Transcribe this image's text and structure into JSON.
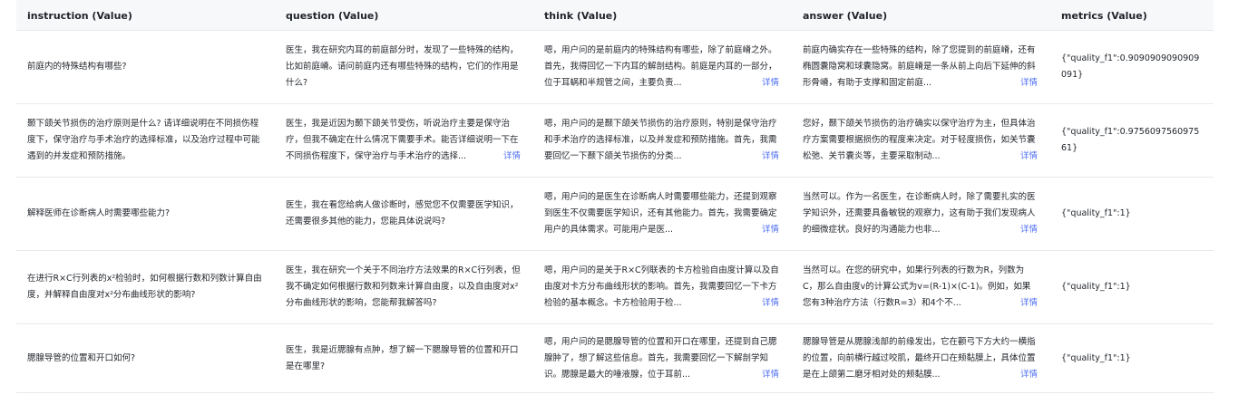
{
  "headers": [
    "instruction (Value)",
    "question (Value)",
    "think (Value)",
    "answer (Value)",
    "metrics (Value)"
  ],
  "more_label": "详情",
  "rows": [
    {
      "instruction": "前庭内的特殊结构有哪些?",
      "question": "医生，我在研究内耳的前庭部分时，发现了一些特殊的结构，比如前庭嵴。请问前庭内还有哪些特殊的结构，它们的作用是什么?",
      "think": "嗯，用户问的是前庭内的特殊结构有哪些，除了前庭嵴之外。首先，我得回忆一下内耳的解剖结构。前庭是内耳的一部分，位于耳蜗和半规管之间，主要负责...",
      "answer": "前庭内确实存在一些特殊的结构，除了您提到的前庭嵴，还有椭圆囊隐窝和球囊隐窝。前庭嵴是一条从前上向后下延伸的斜形骨嵴，有助于支撑和固定前庭...",
      "metrics": "{\"quality_f1\":0.9090909090909091}"
    },
    {
      "instruction": "颞下颌关节损伤的治疗原则是什么? 请详细说明在不同损伤程度下，保守治疗与手术治疗的选择标准，以及治疗过程中可能遇到的并发症和预防措施。",
      "question": "医生，我是近因为颞下颌关节受伤，听说治疗主要是保守治疗，但我不确定在什么情况下需要手术。能否详细说明一下在不同损伤程度下，保守治疗与手术治疗的选择...",
      "think": "嗯，用户问的是颞下颌关节损伤的治疗原则，特别是保守治疗和手术治疗的选择标准，以及并发症和预防措施。首先，我需要回忆一下颞下颌关节损伤的分类...",
      "answer": "您好，颞下颌关节损伤的治疗确实以保守治疗为主，但具体治疗方案需要根据损伤的程度来决定。对于轻度损伤，如关节囊松弛、关节囊炎等，主要采取制动...",
      "metrics": "{\"quality_f1\":0.975609756097561}"
    },
    {
      "instruction": "解释医师在诊断病人时需要哪些能力?",
      "question": "医生，我在看您给病人做诊断时，感觉您不仅需要医学知识，还需要很多其他的能力，您能具体说说吗?",
      "think": "嗯，用户问的是医生在诊断病人时需要哪些能力，还提到观察到医生不仅需要医学知识，还有其他能力。首先，我需要确定用户的具体需求。可能用户是医...",
      "answer": "当然可以。作为一名医生，在诊断病人时，除了需要扎实的医学知识外，还需要具备敏锐的观察力，这有助于我们发现病人的细微症状。良好的沟通能力也非...",
      "metrics": "{\"quality_f1\":1}"
    },
    {
      "instruction": "在进行R×C行列表的x²检验时，如何根据行数和列数计算自由度，并解释自由度对x²分布曲线形状的影响?",
      "question": "医生，我在研究一个关于不同治疗方法效果的R×C行列表，但我不确定如何根据行数和列数来计算自由度，以及自由度对x²分布曲线形状的影响，您能帮我解答吗?",
      "think": "嗯，用户问的是关于R×C列联表的卡方检验自由度计算以及自由度对卡方分布曲线形状的影响。首先，我需要回忆一下卡方检验的基本概念。卡方检验用于检...",
      "answer": "当然可以。在您的研究中，如果行列表的行数为R，列数为C，那么自由度v的计算公式为v=(R-1)×(C-1)。例如，如果您有3种治疗方法（行数R=3）和4个不...",
      "metrics": "{\"quality_f1\":1}"
    },
    {
      "instruction": "腮腺导管的位置和开口如何?",
      "question": "医生，我是近腮腺有点肿，想了解一下腮腺导管的位置和开口是在哪里?",
      "think": "嗯，用户问的是腮腺导管的位置和开口在哪里，还提到自己腮腺肿了，想了解这些信息。首先，我需要回忆一下解剖学知识。腮腺是最大的唾液腺，位于耳前...",
      "answer": "腮腺导管是从腮腺浅部的前缘发出，它在颧弓下方大约一横指的位置，向前横行越过咬肌，最终开口在颊黏膜上，具体位置是在上颌第二磨牙相对处的颊黏膜...",
      "metrics": "{\"quality_f1\":1}"
    }
  ]
}
